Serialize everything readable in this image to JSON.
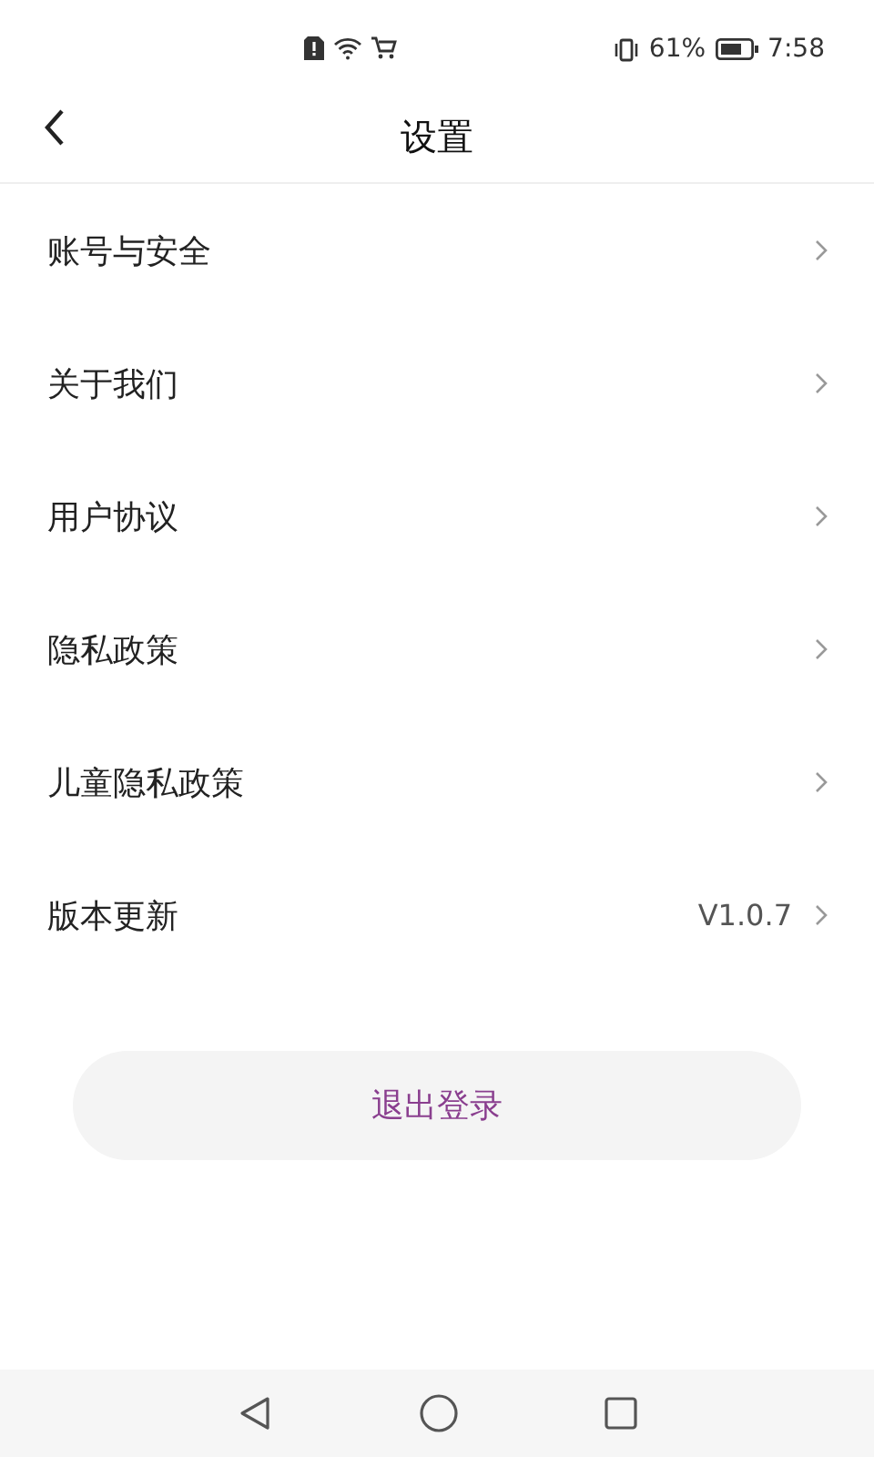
{
  "status_bar": {
    "battery_percent": "61%",
    "time": "7:58"
  },
  "header": {
    "title": "设置"
  },
  "menu": [
    {
      "label": "账号与安全"
    },
    {
      "label": "关于我们"
    },
    {
      "label": "用户协议"
    },
    {
      "label": "隐私政策"
    },
    {
      "label": "儿童隐私政策"
    },
    {
      "label": "版本更新",
      "value": "V1.0.7"
    }
  ],
  "logout_button": "退出登录"
}
